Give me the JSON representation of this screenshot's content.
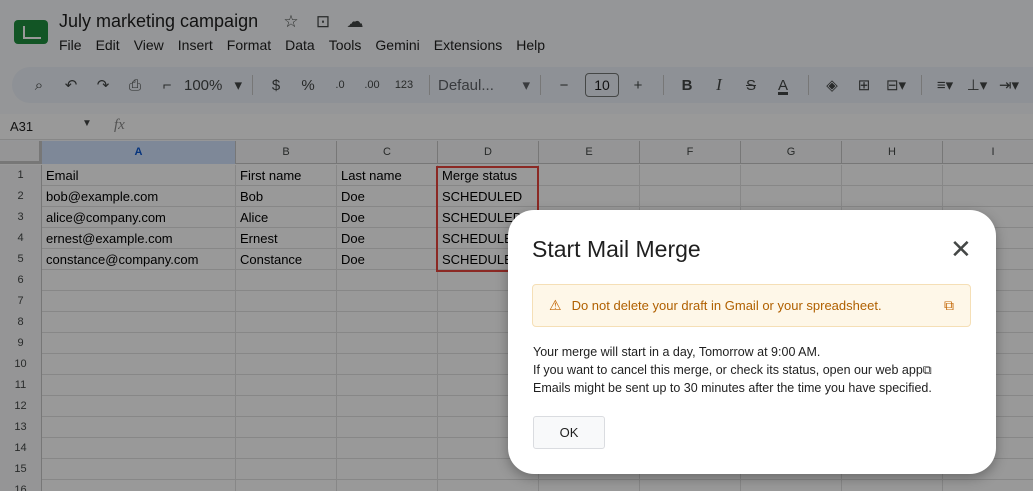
{
  "app": {
    "doc_title": "July marketing campaign",
    "title_icons": [
      "star-icon",
      "move-folder-icon",
      "cloud-status-icon"
    ]
  },
  "menu": [
    "File",
    "Edit",
    "View",
    "Insert",
    "Format",
    "Data",
    "Tools",
    "Gemini",
    "Extensions",
    "Help"
  ],
  "toolbar": {
    "zoom": "100%",
    "currency": "$",
    "percent": "%",
    "decimal_decrease": ".0",
    "decimal_increase": ".00",
    "number_format": "123",
    "font": "Defaul...",
    "font_size": "10",
    "bold": "B",
    "italic": "I",
    "strike": "S",
    "text_color": "A"
  },
  "formula_bar": {
    "name_box": "A31",
    "fx": "fx"
  },
  "columns": [
    "A",
    "B",
    "C",
    "D",
    "E",
    "F",
    "G",
    "H",
    "I"
  ],
  "rows": [
    {
      "num": "1",
      "a": "Email",
      "b": "First name",
      "c": "Last name",
      "d": "Merge status"
    },
    {
      "num": "2",
      "a": "bob@example.com",
      "b": "Bob",
      "c": "Doe",
      "d": "SCHEDULED"
    },
    {
      "num": "3",
      "a": "alice@company.com",
      "b": "Alice",
      "c": "Doe",
      "d": "SCHEDULED"
    },
    {
      "num": "4",
      "a": "ernest@example.com",
      "b": "Ernest",
      "c": "Doe",
      "d": "SCHEDULED"
    },
    {
      "num": "5",
      "a": "constance@company.com",
      "b": "Constance",
      "c": "Doe",
      "d": "SCHEDULED"
    },
    {
      "num": "6"
    },
    {
      "num": "7"
    },
    {
      "num": "8"
    },
    {
      "num": "9"
    },
    {
      "num": "10"
    },
    {
      "num": "11"
    },
    {
      "num": "12"
    },
    {
      "num": "13"
    },
    {
      "num": "14"
    },
    {
      "num": "15"
    },
    {
      "num": "16"
    }
  ],
  "dialog": {
    "title": "Start Mail Merge",
    "warning": "Do not delete your draft in Gmail or your spreadsheet.",
    "body_line1": "Your merge will start in a day, Tomorrow at 9:00 AM.",
    "body_line2": "If you want to cancel this merge, or check its status, open our web app",
    "body_line3": "Emails might be sent up to 30 minutes after the time you have specified.",
    "ok_label": "OK"
  },
  "colors": {
    "highlight": "#e8453c",
    "warning_bg": "#fef7e8",
    "warning_text": "#b06000",
    "brand_green": "#1e8e3e"
  }
}
